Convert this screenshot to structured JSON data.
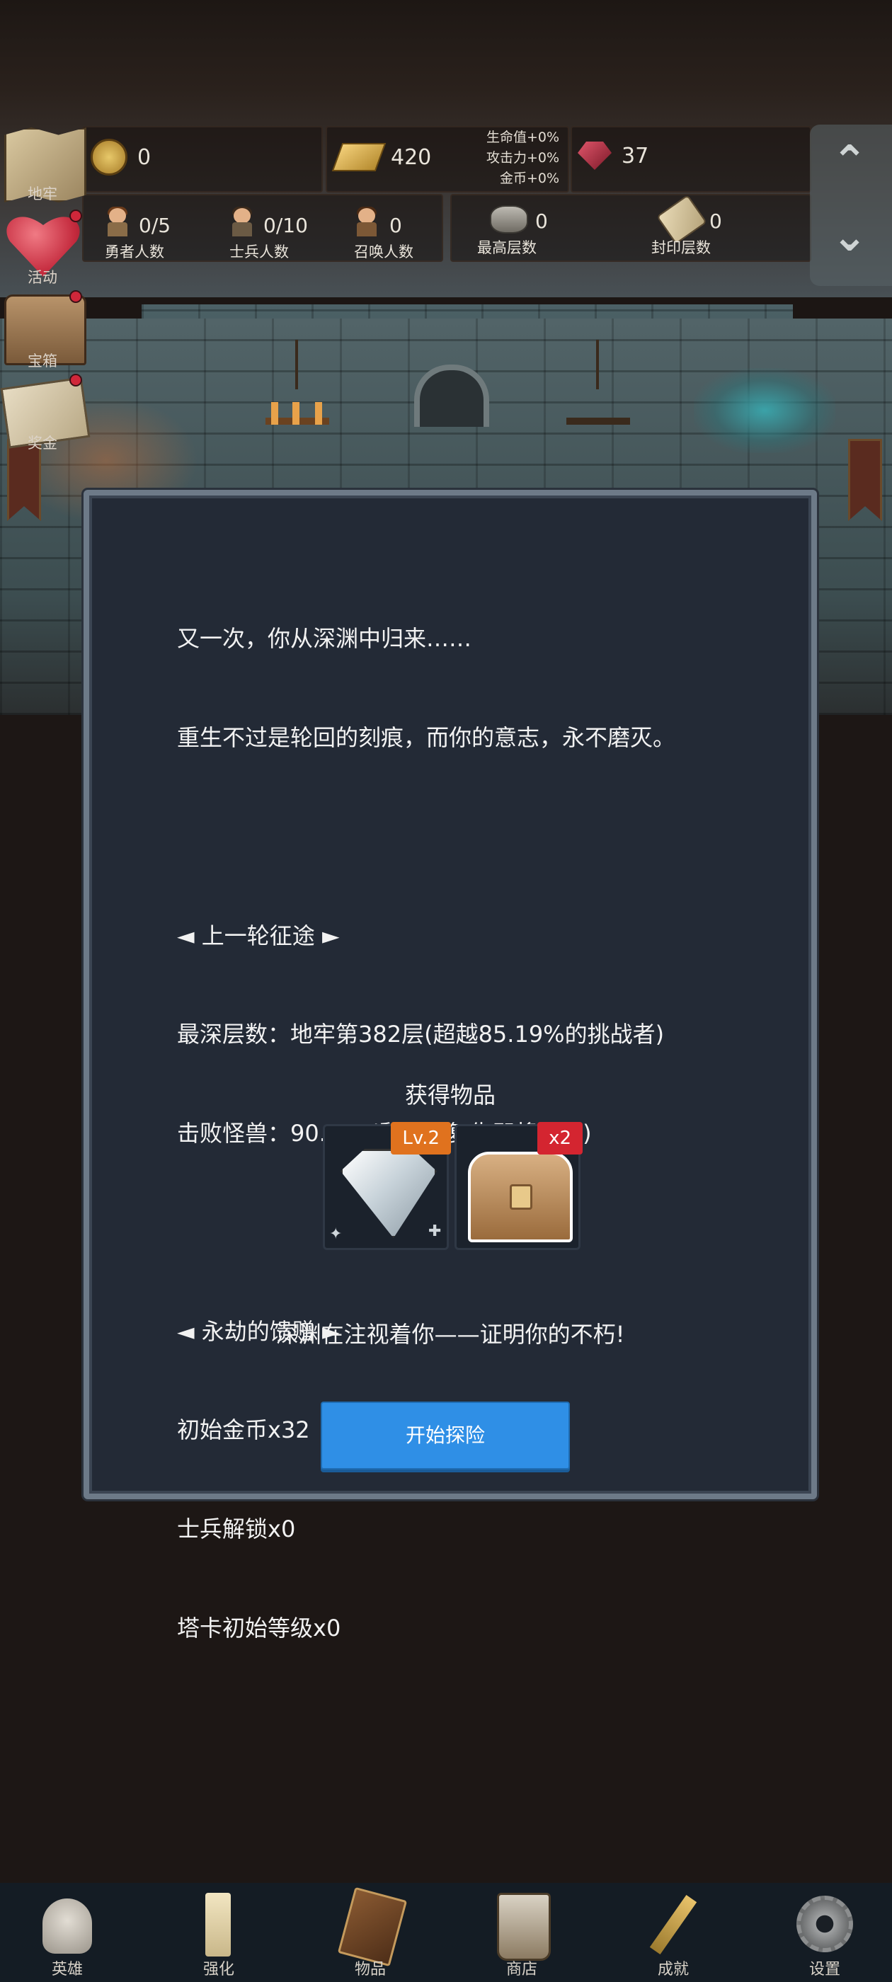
{
  "resources": {
    "coin": "0",
    "gold": "420",
    "gem": "37",
    "bonus": [
      "生命值+0%",
      "攻击力+0%",
      "金币+0%"
    ]
  },
  "stats": {
    "heroes": {
      "value": "0/5",
      "label": "勇者人数"
    },
    "soldiers": {
      "value": "0/10",
      "label": "士兵人数"
    },
    "summons": {
      "value": "0",
      "label": "召唤人数"
    },
    "max_floor": {
      "value": "0",
      "label": "最高层数"
    },
    "sealed_floor": {
      "value": "0",
      "label": "封印层数"
    }
  },
  "side_menu": [
    {
      "label": "地牢",
      "icon": "map-icon"
    },
    {
      "label": "活动",
      "icon": "heart-icon"
    },
    {
      "label": "宝箱",
      "icon": "chest-icon"
    },
    {
      "label": "奖金",
      "icon": "letter-icon"
    }
  ],
  "dialog": {
    "lines": [
      "又一次，你从深渊中归来……",
      "重生不过是轮回的刻痕，而你的意志，永不磨灭。",
      "",
      "◄ 上一轮征途 ►",
      "最深层数：地牢第382层(超越85.19%的挑战者)",
      "击败怪兽：90.69K(黏液的复仇即将到来)",
      "",
      "◄ 永劫的馈赠 ►",
      "初始金币x32",
      "士兵解锁x0",
      "塔卡初始等级x0"
    ],
    "reward_title": "获得物品",
    "rewards": [
      {
        "icon": "diamond-icon",
        "badge": "Lv.2",
        "badge_color": "#e0721e"
      },
      {
        "icon": "treasure-chest-icon",
        "badge": "x2",
        "badge_color": "#d42530"
      }
    ],
    "tagline": "深渊在注视着你——证明你的不朽!",
    "start_button": "开始探险"
  },
  "bottom_nav": [
    {
      "label": "英雄",
      "icon": "skull-icon"
    },
    {
      "label": "强化",
      "icon": "candle-icon"
    },
    {
      "label": "物品",
      "icon": "book-icon"
    },
    {
      "label": "商店",
      "icon": "mug-icon"
    },
    {
      "label": "成就",
      "icon": "key-icon"
    },
    {
      "label": "设置",
      "icon": "gear-icon"
    }
  ],
  "colors": {
    "accent_button": "#2f8fe6",
    "dialog_bg": "#232a36",
    "level_badge": "#e0721e",
    "count_badge": "#d42530"
  }
}
